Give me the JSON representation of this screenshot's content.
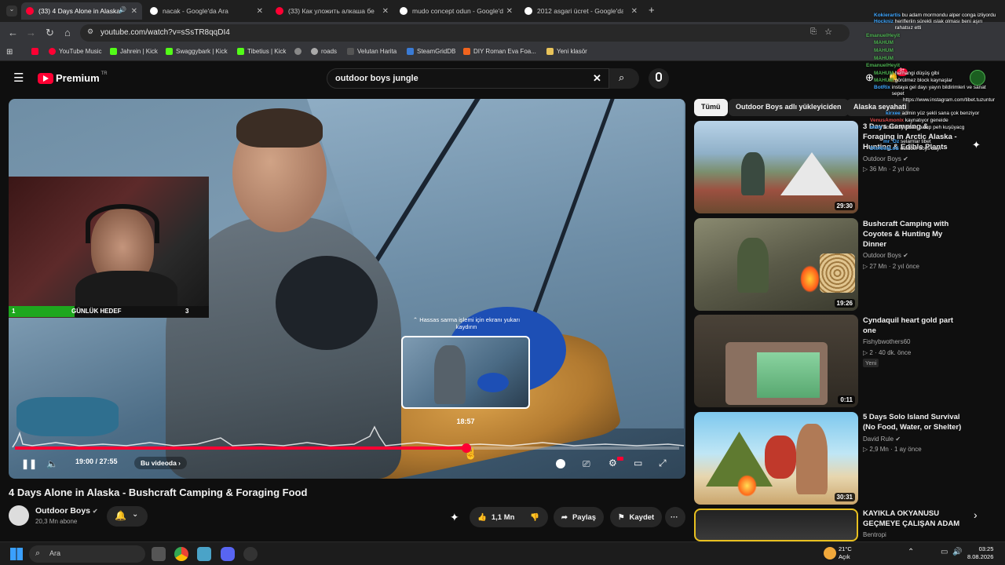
{
  "browser": {
    "tabs": [
      {
        "label": "(33) 4 Days Alone in Alaska",
        "active": true
      },
      {
        "label": "nacak - Google'da Ara",
        "active": false
      },
      {
        "label": "(33) Как уложить алкаша без",
        "active": false
      },
      {
        "label": "mudo concept odun - Google'd",
        "active": false
      },
      {
        "label": "2012 asgari ücret - Google'da A",
        "active": false
      }
    ],
    "url": "youtube.com/watch?v=sSsTR8qqDI4",
    "bookmarks": [
      "YouTube Music",
      "Jahrein | Kick",
      "Swaggybark | Kick",
      "Tibetius | Kick",
      "roads",
      "Velutan Harita",
      "SteamGridDB",
      "DIY Roman Eva Foa...",
      "Yeni klasör"
    ]
  },
  "youtube": {
    "logo": "Premium",
    "logo_region": "TR",
    "search_query": "outdoor boys jungle"
  },
  "player": {
    "current_time": "19:00 / 27:55",
    "chapter_label": "Bu videoda",
    "hover_time": "18:57",
    "hover_hint": "⌃ Hassas sarma işlemi için ekranı yukarı kaydırın",
    "progress_fraction": 0.68,
    "webcam_goal_label": "GÜNLÜK HEDEF",
    "webcam_goal_current": "1",
    "webcam_goal_target": "3"
  },
  "video": {
    "title": "4 Days Alone in Alaska - Bushcraft Camping & Foraging Food",
    "channel": "Outdoor Boys",
    "subscribers": "20,3 Mn abone",
    "likes": "1,1 Mn",
    "share_label": "Paylaş",
    "save_label": "Kaydet"
  },
  "chips": [
    "Tümü",
    "Outdoor Boys adlı yükleyiciden",
    "Alaska seyahati"
  ],
  "recommendations": [
    {
      "title": "3 Days Camping & Foraging in Arctic Alaska - Hunting & Edible Plants",
      "channel": "Outdoor Boys",
      "meta": "36 Mn · 2 yıl önce",
      "duration": "29:30"
    },
    {
      "title": "Bushcraft Camping with Coyotes & Hunting My Dinner",
      "channel": "Outdoor Boys",
      "meta": "27 Mn · 2 yıl önce",
      "duration": "19:26"
    },
    {
      "title": "Cyndaquil heart gold part one",
      "channel": "Fishybwothers60",
      "meta": "2 · 40 dk. önce",
      "duration": "0:11",
      "badge": "Yeni"
    },
    {
      "title": "5 Days Solo Island Survival (No Food, Water, or Shelter)",
      "channel": "David Rule",
      "meta": "2,9 Mn · 1 ay önce",
      "duration": "30:31"
    },
    {
      "title": "KAYIKLA OKYANUSU GEÇMEYE ÇALIŞAN ADAM",
      "channel": "Bentropi",
      "meta": "",
      "duration": ""
    }
  ],
  "chat": [
    {
      "user": "Kokierartis",
      "text": "bu adam mormondu alper conga izliyordu"
    },
    {
      "user": "Hockniz",
      "text": "herifleriin sürekli ıslak olması beni aşırı rahatsız etti"
    },
    {
      "user": "EmanuelHeyit",
      "text": ""
    },
    {
      "user": "MAHUM",
      "text": ""
    },
    {
      "user": "MAHUM",
      "text": ""
    },
    {
      "user": "MAHUM",
      "text": ""
    },
    {
      "user": "EmanuelHeyit",
      "text": ""
    },
    {
      "user": "MAHUM",
      "text": "herhangi düşüş gibi"
    },
    {
      "user": "MAHUM",
      "text": "görülmez block kaynaşlar"
    },
    {
      "user": "BotRix",
      "text": "instaya gel dayı yayın bildirimleri ve sanat sepet"
    },
    {
      "user": "",
      "text": "https://www.instagram.com/tibet.tuzuntur"
    },
    {
      "user": "kirxee",
      "text": "admin yüz şekli sana çok benziyor"
    },
    {
      "user": "VenusAmonix",
      "text": "kaynatıyor geneide"
    },
    {
      "user": "mxm",
      "text": "acubsrfly itibarı bakıp peh kuşüyacg"
    },
    {
      "user": "mr_Oz",
      "text": "selamlar tibet"
    },
    {
      "user": "DtoNickLoS",
      "text": "outdoor boys dayı"
    }
  ],
  "taskbar": {
    "search_label": "Ara",
    "weather_temp": "21°C",
    "weather_desc": "Açık",
    "time": "03:25",
    "date": "8.08.2026"
  },
  "colors": {
    "accent": "#ff0033",
    "bg": "#0f0f0f",
    "chip": "#272727"
  }
}
